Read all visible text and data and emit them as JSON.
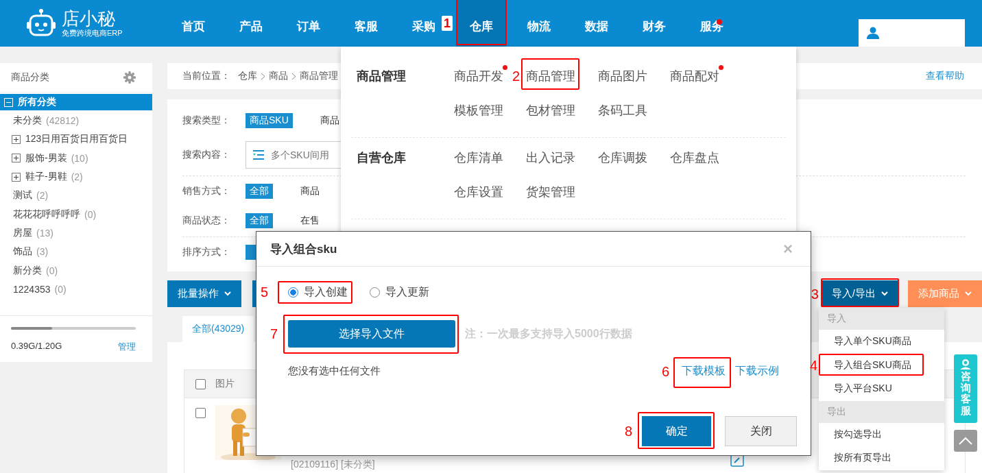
{
  "top_bar": {
    "logo": {
      "name": "店小秘",
      "tagline": "免费跨境电商ERP"
    },
    "nav": [
      {
        "label": "首页",
        "selected": false,
        "dot": false
      },
      {
        "label": "产品",
        "selected": false,
        "dot": false
      },
      {
        "label": "订单",
        "selected": false,
        "dot": false
      },
      {
        "label": "客服",
        "selected": false,
        "dot": false
      },
      {
        "label": "采购",
        "selected": false,
        "dot": false
      },
      {
        "label": "仓库",
        "selected": true,
        "dot": false,
        "callout": "1"
      },
      {
        "label": "物流",
        "selected": false,
        "dot": false
      },
      {
        "label": "数据",
        "selected": false,
        "dot": false
      },
      {
        "label": "财务",
        "selected": false,
        "dot": false
      },
      {
        "label": "服务",
        "selected": false,
        "dot": true
      }
    ]
  },
  "sidebar": {
    "title": "商品分类",
    "categories": [
      {
        "kind": "group",
        "label": "所有分类",
        "expanded": true,
        "selected": true,
        "children": [
          {
            "kind": "leaf",
            "label": "未分类",
            "count": "(42812)",
            "selected": false
          },
          {
            "kind": "group",
            "label": "123日用百货日用百货日",
            "expanded": false,
            "selected": false
          },
          {
            "kind": "group",
            "label": "服饰-男装",
            "count": "(10)",
            "expanded": false,
            "selected": false
          },
          {
            "kind": "group",
            "label": "鞋子-男鞋",
            "count": "(2)",
            "expanded": false,
            "selected": false
          },
          {
            "kind": "leaf",
            "label": "测试",
            "count": "(2)",
            "selected": false
          },
          {
            "kind": "leaf",
            "label": "花花花呼呼呼呼",
            "count": "(0)",
            "selected": false
          },
          {
            "kind": "leaf",
            "label": "房屋",
            "count": "(13)",
            "selected": false
          },
          {
            "kind": "leaf",
            "label": "饰品",
            "count": "(3)",
            "selected": false
          },
          {
            "kind": "leaf",
            "label": "新分类",
            "count": "(0)",
            "selected": false
          },
          {
            "kind": "leaf",
            "label": "1224353",
            "count": "(0)",
            "selected": false
          }
        ]
      }
    ],
    "storage": {
      "level": 0.33,
      "reading": "0.39G/1.20G",
      "manage_link": "管理"
    }
  },
  "breadcrumb": {
    "label": "当前位置：",
    "path": [
      "仓库",
      "商品",
      "商品管理"
    ],
    "help_link": "查看帮助"
  },
  "filters": [
    {
      "kind": "options",
      "label": "搜索类型：",
      "separated": false,
      "options": [
        {
          "text": "商品SKU",
          "selected": true
        },
        {
          "text": "商品",
          "selected": false
        }
      ]
    },
    {
      "kind": "input",
      "label": "搜索内容：",
      "separated": false,
      "placeholder": "多个SKU间用"
    },
    {
      "kind": "options",
      "label": "销售方式：",
      "separated": true,
      "options": [
        {
          "text": "全部",
          "selected": true
        },
        {
          "text": "商品",
          "selected": false
        }
      ]
    },
    {
      "kind": "options",
      "label": "商品状态：",
      "separated": false,
      "options": [
        {
          "text": "全部",
          "selected": true
        },
        {
          "text": "在售",
          "selected": false
        }
      ]
    },
    {
      "kind": "options",
      "label": "排序方式：",
      "separated": true,
      "options": [
        {
          "selected": true
        }
      ]
    }
  ],
  "toolbar": {
    "left": [
      {
        "label": "批量操作",
        "caret": true
      },
      {
        "caret": false
      }
    ],
    "right": [
      {
        "label": "导入/导出",
        "kind": "primary",
        "open": true,
        "callout": "3"
      },
      {
        "label": "添加商品",
        "kind": "accent",
        "open": false
      }
    ]
  },
  "tabs": [
    {
      "label": "全部(43029)",
      "selected": true
    }
  ],
  "table": {
    "header_checked": false,
    "columns": [
      "图片"
    ],
    "rows": [
      {
        "checked": false,
        "kind": "picture",
        "text": "[02109116] [未分类]"
      }
    ]
  },
  "mega_menu": [
    {
      "title": "商品管理",
      "items": [
        {
          "label": "商品开发",
          "dot": true
        },
        {
          "label": "商品管理",
          "dot": false,
          "callout": "2"
        },
        {
          "label": "商品图片",
          "dot": false
        },
        {
          "label": "商品配对",
          "dot": true
        },
        {
          "label": "模板管理",
          "dot": false
        },
        {
          "label": "包材管理",
          "dot": false
        },
        {
          "label": "条码工具",
          "dot": false
        }
      ]
    },
    {
      "title": "自营仓库",
      "items": [
        {
          "label": "仓库清单",
          "dot": false
        },
        {
          "label": "出入记录",
          "dot": false
        },
        {
          "label": "仓库调拨",
          "dot": false
        },
        {
          "label": "仓库盘点",
          "dot": false
        },
        {
          "label": "仓库设置",
          "dot": false
        },
        {
          "label": "货架管理",
          "dot": false
        }
      ]
    }
  ],
  "import_menu": [
    {
      "header": "导入",
      "items": [
        {
          "label": "导入单个SKU商品"
        },
        {
          "label": "导入组合SKU商品",
          "callout": "4"
        },
        {
          "label": "导入平台SKU"
        }
      ]
    },
    {
      "header": "导出",
      "items": [
        {
          "label": "按勾选导出"
        },
        {
          "label": "按所有页导出"
        }
      ]
    }
  ],
  "dialog": {
    "title": "导入组合sku",
    "close": "×",
    "modes": [
      {
        "label": "导入创建",
        "selected": true,
        "callout": "5"
      },
      {
        "label": "导入更新",
        "selected": false
      }
    ],
    "file_button": {
      "label": "选择导入文件",
      "callout": "7"
    },
    "note": "注：一次最多支持导入5000行数据",
    "status": "您没有选中任何文件",
    "links": [
      {
        "label": "下载模板",
        "callout": "6"
      },
      {
        "label": "下载示例"
      }
    ],
    "buttons": [
      {
        "label": "确定",
        "kind": "primary",
        "callout": "8"
      },
      {
        "label": "关闭",
        "kind": "default"
      }
    ]
  },
  "side_widget": {
    "label": "咨询客服"
  }
}
